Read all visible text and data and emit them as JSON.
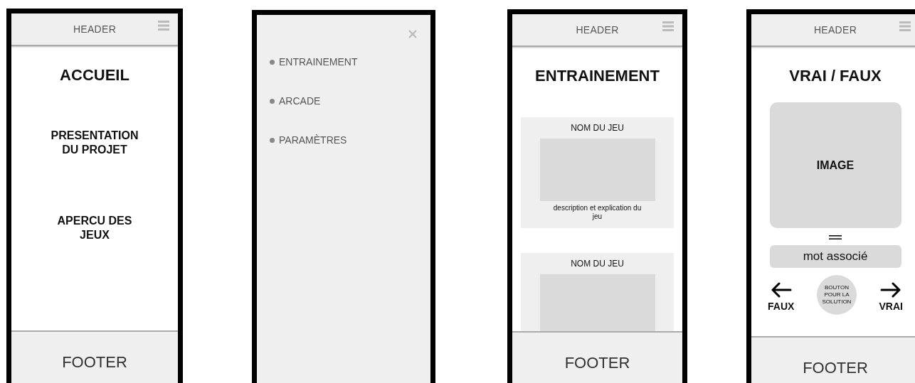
{
  "screens": [
    {
      "kind": "home",
      "header": {
        "title": "HEADER"
      },
      "title": "ACCUEIL",
      "sections": [
        "PRESENTATION DU PROJET",
        "APERCU DES JEUX"
      ],
      "footer": "FOOTER"
    },
    {
      "kind": "menu",
      "items": [
        "ENTRAINEMENT",
        "ARCADE",
        "PARAMÈTRES"
      ]
    },
    {
      "kind": "list",
      "header": {
        "title": "HEADER"
      },
      "title": "ENTRAINEMENT",
      "games": [
        {
          "name": "NOM DU JEU",
          "description": "description et explication du jeu"
        },
        {
          "name": "NOM DU JEU"
        }
      ],
      "footer": "FOOTER"
    },
    {
      "kind": "quiz",
      "header": {
        "title": "HEADER"
      },
      "title": "VRAI / FAUX",
      "image_label": "IMAGE",
      "word": "mot associé",
      "left_label": "FAUX",
      "solution_button": "BOUTON POUR LA SOLUTION",
      "right_label": "VRAI",
      "footer": "FOOTER"
    }
  ]
}
